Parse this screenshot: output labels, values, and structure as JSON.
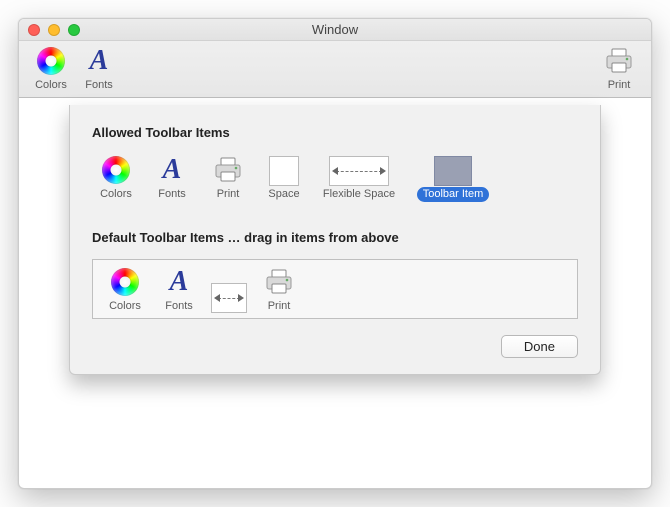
{
  "window": {
    "title": "Window"
  },
  "toolbar": {
    "items": [
      {
        "label": "Colors",
        "icon": "colorwheel-icon"
      },
      {
        "label": "Fonts",
        "icon": "fonts-icon"
      }
    ],
    "right": [
      {
        "label": "Print",
        "icon": "printer-icon"
      }
    ]
  },
  "sheet": {
    "allowed_title": "Allowed Toolbar Items",
    "allowed": [
      {
        "label": "Colors",
        "icon": "colorwheel-icon",
        "kind": "icon"
      },
      {
        "label": "Fonts",
        "icon": "fonts-icon",
        "kind": "icon"
      },
      {
        "label": "Print",
        "icon": "printer-icon",
        "kind": "icon"
      },
      {
        "label": "Space",
        "icon": "space-icon",
        "kind": "space"
      },
      {
        "label": "Flexible Space",
        "icon": "flex-space-icon",
        "kind": "flex"
      },
      {
        "label": "Toolbar Item",
        "icon": "custom-icon",
        "kind": "custom",
        "selected": true
      }
    ],
    "default_title": "Default Toolbar Items … drag in items from above",
    "default": [
      {
        "label": "Colors",
        "icon": "colorwheel-icon",
        "kind": "icon"
      },
      {
        "label": "Fonts",
        "icon": "fonts-icon",
        "kind": "icon"
      },
      {
        "label": "",
        "icon": "flex-space-icon",
        "kind": "flex"
      },
      {
        "label": "Print",
        "icon": "printer-icon",
        "kind": "icon"
      }
    ],
    "done_label": "Done"
  }
}
